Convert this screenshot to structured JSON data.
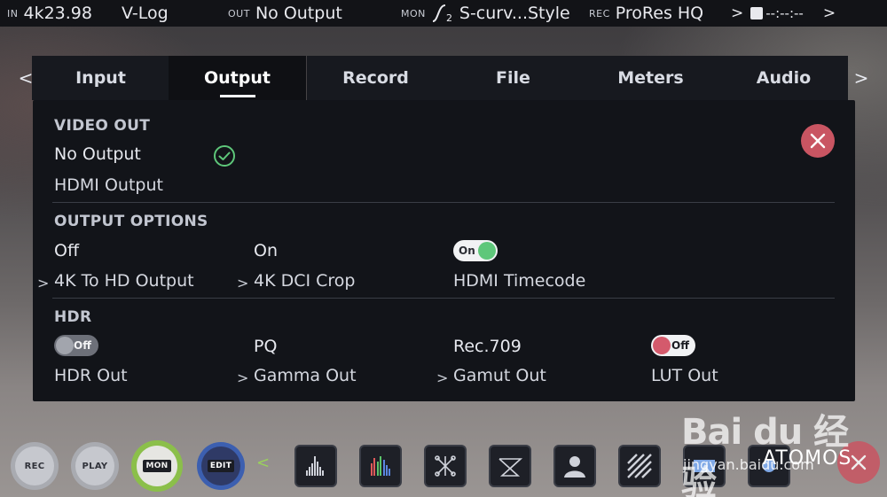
{
  "status_bar": {
    "in_label": "IN",
    "in_resolution": "4k23.98",
    "log_format": "V-Log",
    "out_label": "OUT",
    "out_value": "No Output",
    "mon_label": "MON",
    "mon_icon": "s-curve-icon",
    "mon_value": "S-curv...Style",
    "rec_label": "REC",
    "rec_codec": "ProRes HQ",
    "rec_arrow": ">",
    "timecode": "--:--:--",
    "more_arrow": ">"
  },
  "tabs": [
    {
      "label": "Input",
      "active": false
    },
    {
      "label": "Output",
      "active": true
    },
    {
      "label": "Record",
      "active": false
    },
    {
      "label": "File",
      "active": false
    },
    {
      "label": "Meters",
      "active": false
    },
    {
      "label": "Audio",
      "active": false
    }
  ],
  "tab_nav": {
    "prev": "<",
    "next": ">"
  },
  "video_out": {
    "title": "VIDEO OUT",
    "option_no_output": "No Output",
    "option_hdmi_output": "HDMI Output",
    "selected": "No Output"
  },
  "output_options": {
    "title": "OUTPUT OPTIONS",
    "k4_to_hd": {
      "value": "Off",
      "label": "4K To HD Output"
    },
    "k4_dci_crop": {
      "value": "On",
      "label": "4K DCI Crop"
    },
    "hdmi_timecode": {
      "toggle": "On",
      "label": "HDMI Timecode"
    }
  },
  "hdr": {
    "title": "HDR",
    "hdr_out": {
      "toggle": "Off",
      "label": "HDR Out"
    },
    "gamma_out": {
      "value": "PQ",
      "label": "Gamma Out"
    },
    "gamut_out": {
      "value": "Rec.709",
      "label": "Gamut Out"
    },
    "lut_out": {
      "toggle": "Off",
      "label": "LUT Out"
    }
  },
  "chevron": ">",
  "dock": {
    "rec": "REC",
    "play": "PLAY",
    "mon": "MON",
    "edit": "EDIT",
    "chevron": "<",
    "tools": [
      "waveform-icon",
      "vectorscope-icon",
      "focus-peaking-icon",
      "zebra-icon",
      "false-color-icon",
      "stripes-icon",
      "frame-guide-icon",
      "anamorphic-icon"
    ]
  },
  "watermark": {
    "logo": "Bai du 经验",
    "url": "jingyan.baidu.com",
    "brand": "ATOMOS"
  },
  "colors": {
    "accent_green": "#5ec77a",
    "close_red": "#c95562",
    "mon_green": "#8bbf4a",
    "edit_blue": "#3c5fb0"
  }
}
